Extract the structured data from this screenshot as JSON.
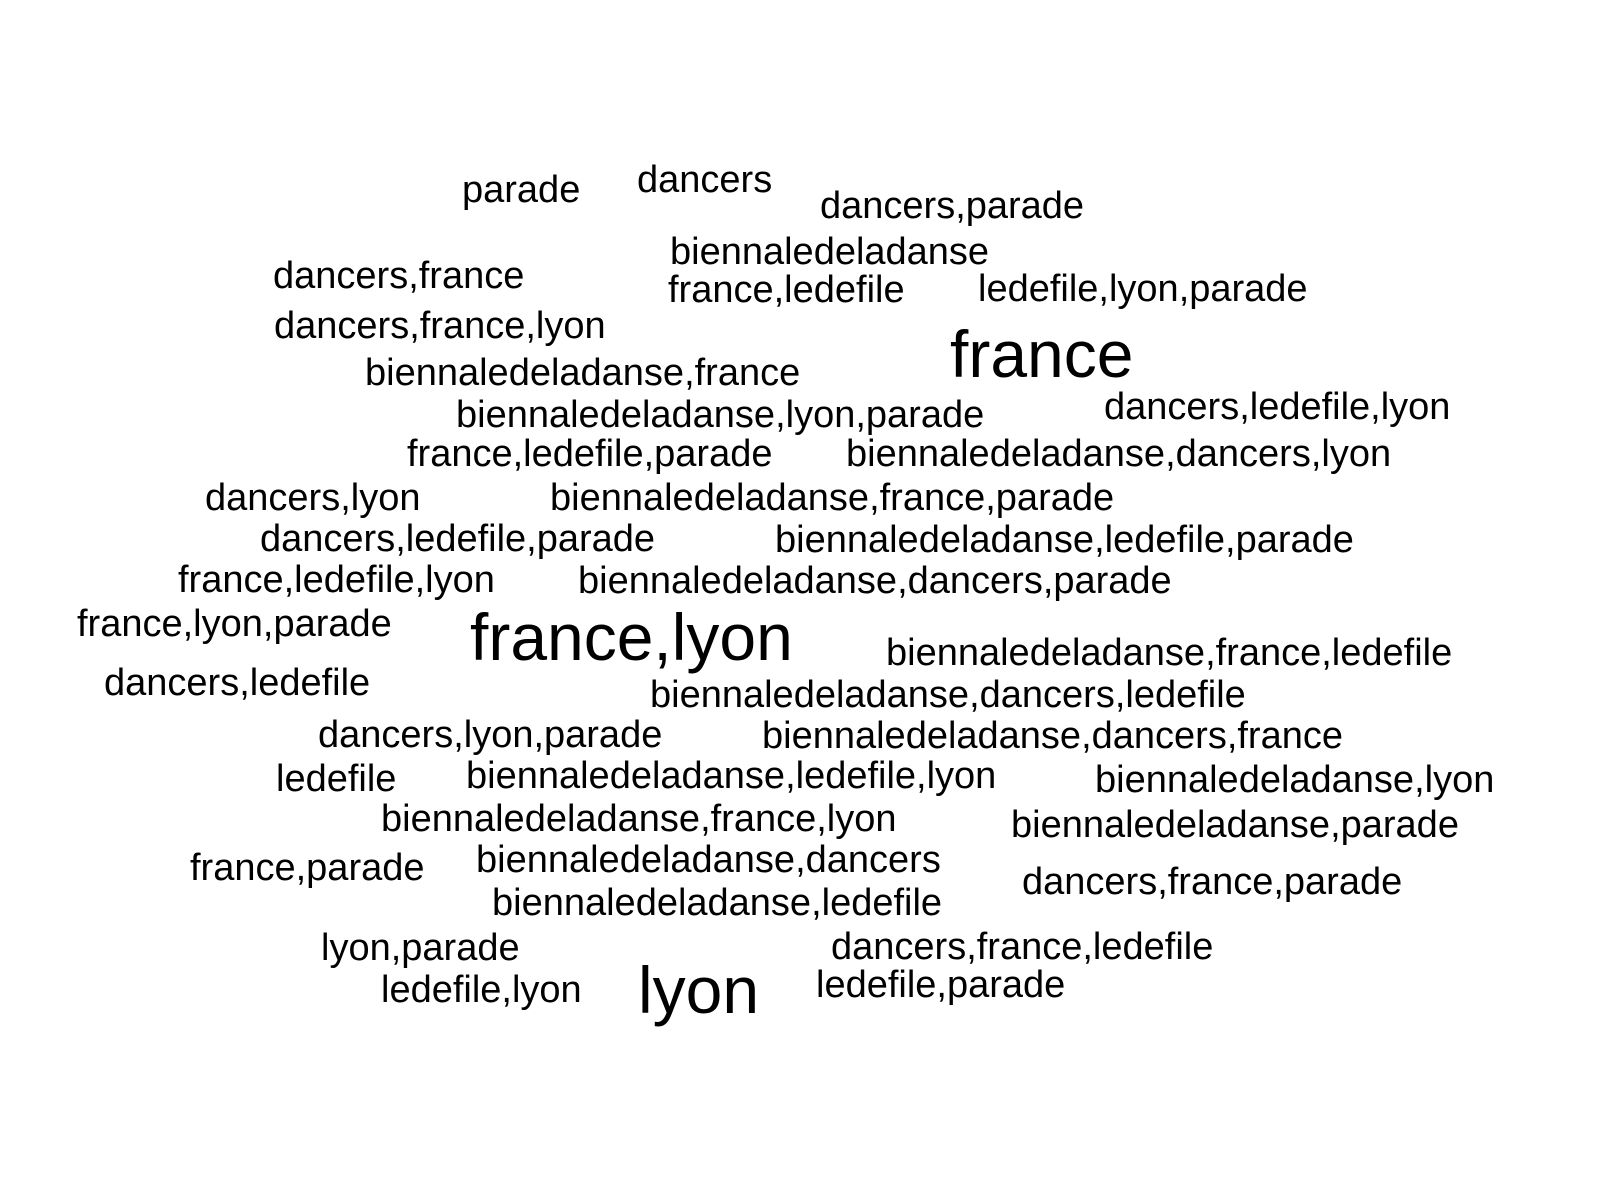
{
  "words": [
    {
      "text": "parade",
      "weight": 1
    },
    {
      "text": "dancers",
      "weight": 1
    },
    {
      "text": "dancers,parade",
      "weight": 1
    },
    {
      "text": "biennaledeladanse",
      "weight": 1
    },
    {
      "text": "dancers,france",
      "weight": 1
    },
    {
      "text": "france,ledefile",
      "weight": 1
    },
    {
      "text": "ledefile,lyon,parade",
      "weight": 1
    },
    {
      "text": "dancers,france,lyon",
      "weight": 1
    },
    {
      "text": "france",
      "weight": 2
    },
    {
      "text": "biennaledeladanse,france",
      "weight": 1
    },
    {
      "text": "biennaledeladanse,lyon,parade",
      "weight": 1
    },
    {
      "text": "dancers,ledefile,lyon",
      "weight": 1
    },
    {
      "text": "france,ledefile,parade",
      "weight": 1
    },
    {
      "text": "biennaledeladanse,dancers,lyon",
      "weight": 1
    },
    {
      "text": "dancers,lyon",
      "weight": 1
    },
    {
      "text": "biennaledeladanse,france,parade",
      "weight": 1
    },
    {
      "text": "dancers,ledefile,parade",
      "weight": 1
    },
    {
      "text": "biennaledeladanse,ledefile,parade",
      "weight": 1
    },
    {
      "text": "france,ledefile,lyon",
      "weight": 1
    },
    {
      "text": "biennaledeladanse,dancers,parade",
      "weight": 1
    },
    {
      "text": "france,lyon,parade",
      "weight": 1
    },
    {
      "text": "france,lyon",
      "weight": 2
    },
    {
      "text": "biennaledeladanse,france,ledefile",
      "weight": 1
    },
    {
      "text": "dancers,ledefile",
      "weight": 1
    },
    {
      "text": "biennaledeladanse,dancers,ledefile",
      "weight": 1
    },
    {
      "text": "dancers,lyon,parade",
      "weight": 1
    },
    {
      "text": "biennaledeladanse,dancers,france",
      "weight": 1
    },
    {
      "text": "ledefile",
      "weight": 1
    },
    {
      "text": "biennaledeladanse,ledefile,lyon",
      "weight": 1
    },
    {
      "text": "biennaledeladanse,lyon",
      "weight": 1
    },
    {
      "text": "biennaledeladanse,france,lyon",
      "weight": 1
    },
    {
      "text": "biennaledeladanse,parade",
      "weight": 1
    },
    {
      "text": "france,parade",
      "weight": 1
    },
    {
      "text": "biennaledeladanse,dancers",
      "weight": 1
    },
    {
      "text": "dancers,france,parade",
      "weight": 1
    },
    {
      "text": "biennaledeladanse,ledefile",
      "weight": 1
    },
    {
      "text": "lyon,parade",
      "weight": 1
    },
    {
      "text": "dancers,france,ledefile",
      "weight": 1
    },
    {
      "text": "ledefile,lyon",
      "weight": 1
    },
    {
      "text": "lyon",
      "weight": 2
    },
    {
      "text": "ledefile,parade",
      "weight": 1
    }
  ],
  "colors": {
    "text": "#000000",
    "background": "#ffffff"
  }
}
